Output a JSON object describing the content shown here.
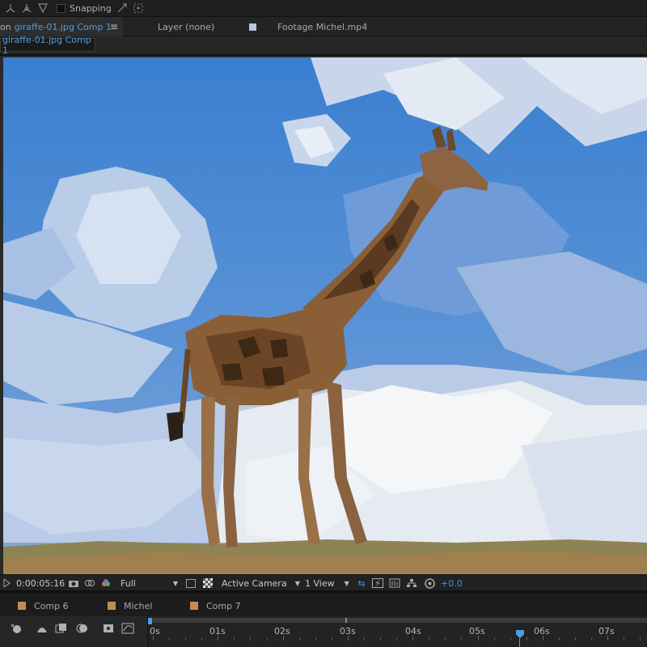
{
  "toolbar": {
    "snapping_label": "Snapping"
  },
  "tabs": {
    "composition_prefix": "on",
    "composition_name": "giraffe-01.jpg Comp 1",
    "layer_tab": "Layer (none)",
    "footage_tab": "Footage Michel.mp4"
  },
  "comp_chip": "giraffe-01.jpg Comp 1",
  "viewer_bar": {
    "timecode": "0:00:05:16",
    "resolution": "Full",
    "camera": "Active Camera",
    "views": "1 View",
    "exposure": "+0.0"
  },
  "timeline_tabs": [
    {
      "label": "Comp 6"
    },
    {
      "label": "Michel"
    },
    {
      "label": "Comp 7"
    }
  ],
  "ruler": {
    "ticks": [
      "0s",
      "01s",
      "02s",
      "03s",
      "04s",
      "05s",
      "06s",
      "07s"
    ]
  },
  "colors": {
    "accent": "#4f9de0",
    "label_swatch": "#c48a54",
    "sky": "#3f7fcf"
  }
}
